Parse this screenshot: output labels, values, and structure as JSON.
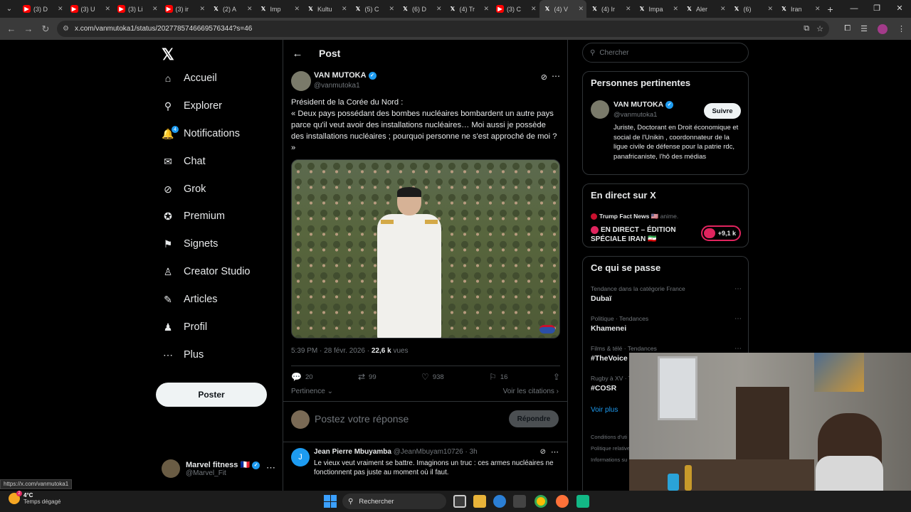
{
  "browser": {
    "tabs": [
      {
        "fav": "yt",
        "title": "(3) D"
      },
      {
        "fav": "yt",
        "title": "(3) U"
      },
      {
        "fav": "yt",
        "title": "(3) Li"
      },
      {
        "fav": "yt",
        "title": "(3) ir"
      },
      {
        "fav": "x",
        "title": "(2) A"
      },
      {
        "fav": "x",
        "title": "Imp"
      },
      {
        "fav": "x",
        "title": "Kultu"
      },
      {
        "fav": "x",
        "title": "(5) C"
      },
      {
        "fav": "x",
        "title": "(6) D"
      },
      {
        "fav": "x",
        "title": "(4) Tr"
      },
      {
        "fav": "yt",
        "title": "(3) C"
      },
      {
        "fav": "x",
        "title": "(4) V",
        "active": true
      },
      {
        "fav": "x",
        "title": "(4) Ir"
      },
      {
        "fav": "x",
        "title": "Impa"
      },
      {
        "fav": "x",
        "title": "Aler"
      },
      {
        "fav": "x",
        "title": "(6)"
      },
      {
        "fav": "x",
        "title": "Iran"
      }
    ],
    "url": "x.com/vanmutoka1/status/2027785746669576344?s=46",
    "status_url": "https://x.com/vanmutoka1"
  },
  "leftnav": {
    "items": [
      {
        "id": "home",
        "label": "Accueil",
        "icon": "⌂"
      },
      {
        "id": "explore",
        "label": "Explorer",
        "icon": "⚲"
      },
      {
        "id": "notifications",
        "label": "Notifications",
        "icon": "🔔",
        "badge": "4"
      },
      {
        "id": "chat",
        "label": "Chat",
        "icon": "✉"
      },
      {
        "id": "grok",
        "label": "Grok",
        "icon": "⊘"
      },
      {
        "id": "premium",
        "label": "Premium",
        "icon": "✪"
      },
      {
        "id": "bookmarks",
        "label": "Signets",
        "icon": "⚑"
      },
      {
        "id": "creator",
        "label": "Creator Studio",
        "icon": "♙"
      },
      {
        "id": "articles",
        "label": "Articles",
        "icon": "✎"
      },
      {
        "id": "profile",
        "label": "Profil",
        "icon": "♟"
      },
      {
        "id": "more",
        "label": "Plus",
        "icon": "⋯"
      }
    ],
    "post_button": "Poster",
    "account": {
      "name": "Marvel fitness",
      "flag": "🇫🇷",
      "handle": "@Marvel_Fit"
    }
  },
  "post": {
    "header_title": "Post",
    "author_name": "VAN MUTOKA",
    "author_handle": "@vanmutoka1",
    "text_line1": "Président de la Corée du Nord :",
    "text_line2": "« Deux pays possédant des bombes  nucléaires bombardent un autre pays parce qu'il veut avoir des installations nucléaires… Moi aussi je possède des installations nucléaires ; pourquoi personne ne s'est approché de moi ? »",
    "time": "5:39 PM · 28 févr. 2026 ·",
    "views_count": "22,6 k",
    "views_label": "vues",
    "replies": "20",
    "reposts": "99",
    "likes": "938",
    "bookmarks": "16",
    "sort_label": "Pertinence",
    "quotes_label": "Voir les citations",
    "reply_placeholder": "Postez votre réponse",
    "reply_button": "Répondre"
  },
  "comment": {
    "avatar_letter": "J",
    "name": "Jean Pierre Mbuyamba",
    "handle": "@JeanMbuyam10726",
    "time": "· 3h",
    "text": "Le vieux veut vraiment se battre.  Imaginons un truc : ces armes nucléaires ne fonctionnent pas juste au moment où il faut."
  },
  "right": {
    "search_placeholder": "Chercher",
    "people_title": "Personnes pertinentes",
    "person": {
      "name": "VAN MUTOKA",
      "handle": "@vanmutoka1",
      "follow": "Suivre",
      "bio": "Juriste, Doctorant en Droit économique et social de l'Unikin , coordonnateur de la ligue civile de défense pour la patrie rdc, panafricaniste, l'hô des médias"
    },
    "live_title": "En direct sur X",
    "live_host": "Trump Fact News 🇺🇸",
    "live_host_role": "anime.",
    "live_text": "EN DIRECT – ÉDITION SPÉCIALE IRAN 🇮🇷",
    "live_listeners": "+9,1 k",
    "trends_title": "Ce qui se passe",
    "trends": [
      {
        "cat": "Tendance dans la catégorie France",
        "name": "Dubaï"
      },
      {
        "cat": "Politique · Tendances",
        "name": "Khamenei"
      },
      {
        "cat": "Films & télé · Tendances",
        "name": "#TheVoice"
      },
      {
        "cat": "Rugby à XV · Tendances",
        "name": "#COSR"
      }
    ],
    "show_more": "Voir plus",
    "footer": [
      "Conditions d'uti",
      "Politique relative",
      "Informations su"
    ]
  },
  "taskbar": {
    "weather_temp": "4°C",
    "weather_desc": "Temps dégagé",
    "weather_badge": "2",
    "search": "Rechercher"
  }
}
